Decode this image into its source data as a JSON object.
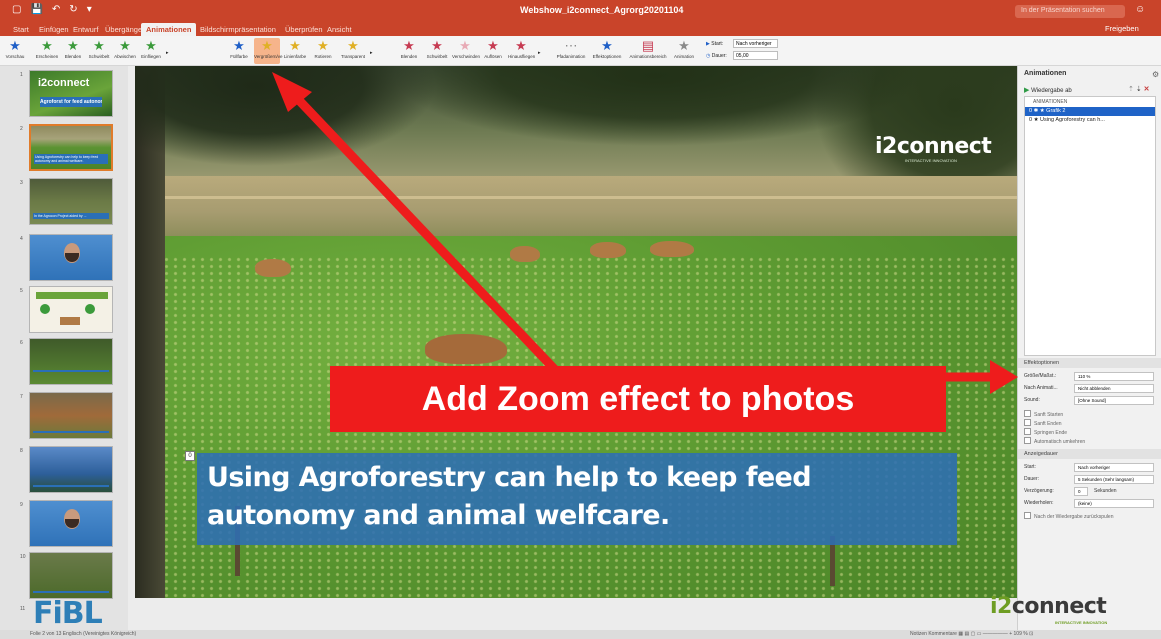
{
  "titlebar": {
    "quick_access": [
      "▢",
      "💾",
      "↶",
      "↻",
      "▾"
    ],
    "doc_title": "Webshow_i2connect_Agrorg20201104",
    "search_placeholder": "In der Präsentation suchen",
    "account_icon": "☺"
  },
  "tabs": [
    "Start",
    "Einfügen",
    "Entwurf",
    "Übergänge",
    "Animationen",
    "Bildschirmpräsentation",
    "Überprüfen",
    "Ansicht"
  ],
  "share_label": "Freigeben",
  "ribbon": {
    "preview_label": "Vorschau",
    "entrance": [
      "Erscheinen",
      "Blenden",
      "Schwirbelt",
      "Abwischen",
      "Einfliegen"
    ],
    "emphasis": [
      "Füllfarbe",
      "Vergrößern/ve",
      "Linienfarbe",
      "Rotieren",
      "Transparent"
    ],
    "exit": [
      "Blenden",
      "Schwirbelt",
      "Verschwinden",
      "Auflösen",
      "Hinausfliegen"
    ],
    "motion_path": "Pfadanimation",
    "effect_options": "Effektoptionen",
    "animation_pane": "Animationsbereich",
    "reorder": "Animation",
    "start_label": "Start:",
    "start_value": "Nach vorheriger",
    "duration_label": "Dauer:",
    "duration_value": "05,00"
  },
  "slide_numbers": [
    "1",
    "2",
    "3",
    "4",
    "5",
    "6",
    "7",
    "8",
    "9",
    "10",
    "11"
  ],
  "thumbs": {
    "t1_logo": "i2connect",
    "t1_title": "Agroforst for feed autonomy",
    "t2_caption": "Using Agroforestry can help to keep feed autonomy and animal welfcare.",
    "t3_caption": "In the Agrocon Project aided by ..."
  },
  "fibl_logo": "FiBL",
  "slide": {
    "logo": "i2connect",
    "logo_sub": "INTERACTIVE INNOVATION",
    "caption": "Using Agroforestry can help to keep feed\nautonomy and animal welfcare.",
    "anim_marker": "0"
  },
  "pane": {
    "title": "Animationen",
    "play_label": "Wiedergabe ab",
    "list_header": "ANIMATIONEN",
    "items": [
      "0  ✱  ★  Grafik 2",
      "0     ★  Using Agroforestry can h..."
    ],
    "effect_section": "Effektoptionen",
    "size_label": "Größe/Maßst.:",
    "size_value": "110 %",
    "after_anim_label": "Nach Animati...",
    "after_anim_value": "Nicht abblenden",
    "sound_label": "Sound:",
    "sound_value": "[Ohne Sound]",
    "checks": [
      "Sanft Starten",
      "Sanft Enden",
      "Springen Ende",
      "Automatisch umkehren"
    ],
    "timing_section": "Anzeigedauer",
    "start_label": "Start:",
    "start_value": "Nach vorheriger",
    "duration_label": "Dauer:",
    "duration_value": "5 Sekunden (Sehr langsam)",
    "delay_label": "Verzögerung:",
    "delay_value": "0",
    "delay_unit": "Sekunden",
    "repeat_label": "Wiederholen:",
    "repeat_value": "(keine)",
    "rewind_label": "Nach der Wiedergabe zurückspulen"
  },
  "i2_bottom": {
    "prefix": "i2",
    "rest": "connect",
    "sub": "INTERACTIVE INNOVATION"
  },
  "status": {
    "left": "Folie 2 von 13   Englisch (Vereinigtes Königreich)",
    "right": "Notizen   Kommentare   ▦  ▤  ▢  ▭   —————  +   109 %   ⊡"
  },
  "annotation": {
    "label": "Add Zoom effect to photos"
  },
  "colors": {
    "accent": "#c9442a",
    "annotation": "#ee1c1c",
    "caption_bg": "#2d6eb4",
    "selected": "#1f63c7"
  }
}
